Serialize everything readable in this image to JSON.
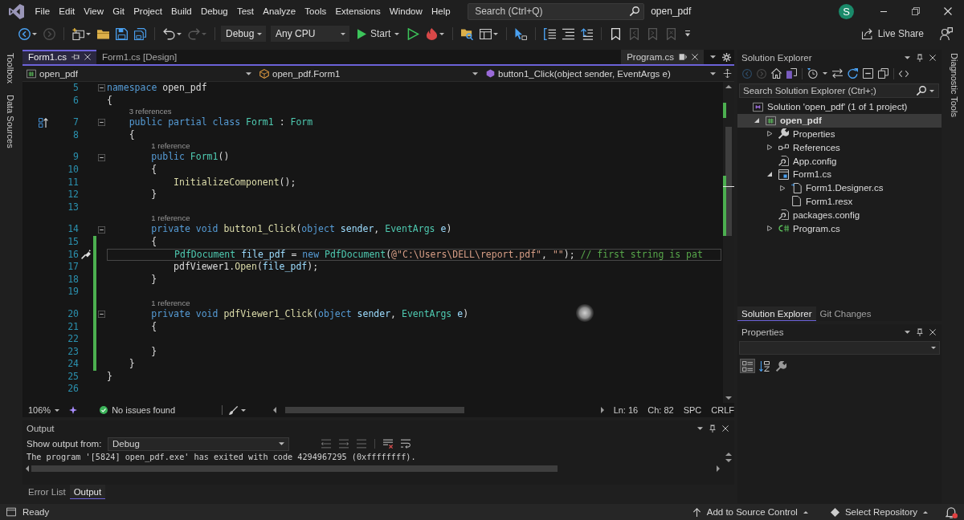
{
  "window": {
    "menu": [
      "File",
      "Edit",
      "View",
      "Git",
      "Project",
      "Build",
      "Debug",
      "Test",
      "Analyze",
      "Tools",
      "Extensions",
      "Window",
      "Help"
    ],
    "search": {
      "placeholder": "Search (Ctrl+Q)"
    },
    "title": "open_pdf",
    "account": {
      "initial": "S"
    }
  },
  "toolbar": {
    "groups_before": [
      [
        {
          "kind": "back",
          "dropdown": true,
          "disabled": false
        },
        {
          "kind": "forward",
          "dropdown": false,
          "disabled": true
        }
      ],
      [
        {
          "kind": "new",
          "dropdown": true,
          "disabled": false
        },
        {
          "kind": "open",
          "dropdown": false,
          "disabled": false
        },
        {
          "kind": "save",
          "dropdown": false,
          "disabled": false
        },
        {
          "kind": "save_all",
          "dropdown": false,
          "disabled": false
        }
      ],
      [
        {
          "kind": "undo",
          "dropdown": true,
          "disabled": false
        },
        {
          "kind": "redo",
          "dropdown": true,
          "disabled": true
        }
      ]
    ],
    "configuration": "Debug",
    "platform": "Any CPU",
    "start": "Start",
    "groups_after": [
      [
        {
          "kind": "run",
          "dropdown": false,
          "disabled": false
        },
        {
          "kind": "hot_reload",
          "dropdown": true,
          "disabled": false
        }
      ],
      [
        {
          "kind": "browse",
          "dropdown": false,
          "disabled": false
        },
        {
          "kind": "layout",
          "dropdown": true,
          "disabled": false
        }
      ],
      [
        {
          "kind": "select",
          "dropdown": false,
          "disabled": false
        }
      ],
      [
        {
          "kind": "format",
          "dropdown": false,
          "disabled": false
        },
        {
          "kind": "comment",
          "dropdown": false,
          "disabled": false
        },
        {
          "kind": "uncomment",
          "dropdown": false,
          "disabled": false
        }
      ],
      [
        {
          "kind": "bookmark",
          "dropdown": false,
          "disabled": false
        },
        {
          "kind": "bookmark_prev",
          "dropdown": false,
          "disabled": true
        },
        {
          "kind": "bookmark_next",
          "dropdown": false,
          "disabled": true
        },
        {
          "kind": "bookmark_clear",
          "dropdown": false,
          "disabled": true
        }
      ]
    ],
    "live_share": "Live Share"
  },
  "left_strip": [
    "Toolbox",
    "Data Sources"
  ],
  "editor": {
    "tabs": [
      {
        "label": "Form1.cs",
        "selected": true
      },
      {
        "label": "Form1.cs [Design]",
        "selected": false
      }
    ],
    "preview_tab": {
      "label": "Program.cs"
    },
    "nav": {
      "project": "open_pdf",
      "type": "open_pdf.Form1",
      "member": "button1_Click(object sender, EventArgs e)"
    },
    "lines": [
      {
        "kind": "code",
        "number": "5",
        "tokens": [
          {
            "text": "namespace",
            "kind": "keyword"
          },
          {
            "text": " open_pdf",
            "kind": "plain"
          }
        ],
        "fold": true,
        "changed": false,
        "current": false
      },
      {
        "kind": "code",
        "number": "6",
        "tokens": [
          {
            "text": "{",
            "kind": "plain"
          }
        ],
        "fold": false,
        "changed": false,
        "current": false
      },
      {
        "kind": "codelens",
        "text": "3 references",
        "changed": false
      },
      {
        "kind": "code",
        "number": "7",
        "tokens": [
          {
            "text": "    public partial class",
            "kind": "keyword"
          },
          {
            "text": " Form1",
            "kind": "type"
          },
          {
            "text": " : ",
            "kind": "plain"
          },
          {
            "text": "Form",
            "kind": "type"
          }
        ],
        "fold": true,
        "changed": false,
        "current": false,
        "margin_icon": {
          "kind": "inheritance"
        }
      },
      {
        "kind": "code",
        "number": "8",
        "tokens": [
          {
            "text": "    {",
            "kind": "plain"
          }
        ],
        "fold": false,
        "changed": false,
        "current": false
      },
      {
        "kind": "codelens",
        "text": "1 reference",
        "changed": false
      },
      {
        "kind": "code",
        "number": "9",
        "tokens": [
          {
            "text": "        public",
            "kind": "keyword"
          },
          {
            "text": " Form1",
            "kind": "type"
          },
          {
            "text": "()",
            "kind": "plain"
          }
        ],
        "fold": true,
        "changed": false,
        "current": false
      },
      {
        "kind": "code",
        "number": "10",
        "tokens": [
          {
            "text": "        {",
            "kind": "plain"
          }
        ],
        "fold": false,
        "changed": false,
        "current": false
      },
      {
        "kind": "code",
        "number": "11",
        "tokens": [
          {
            "text": "            InitializeComponent",
            "kind": "method"
          },
          {
            "text": "();",
            "kind": "plain"
          }
        ],
        "fold": false,
        "changed": false,
        "current": false
      },
      {
        "kind": "code",
        "number": "12",
        "tokens": [
          {
            "text": "        }",
            "kind": "plain"
          }
        ],
        "fold": false,
        "changed": false,
        "current": false
      },
      {
        "kind": "code",
        "number": "13",
        "fold": false,
        "changed": false,
        "current": false
      },
      {
        "kind": "codelens",
        "text": "1 reference",
        "changed": false
      },
      {
        "kind": "code",
        "number": "14",
        "tokens": [
          {
            "text": "        private void",
            "kind": "keyword"
          },
          {
            "text": " button1_Click",
            "kind": "method"
          },
          {
            "text": "(",
            "kind": "plain"
          },
          {
            "text": "object",
            "kind": "keyword"
          },
          {
            "text": " sender",
            "kind": "param"
          },
          {
            "text": ", ",
            "kind": "plain"
          },
          {
            "text": "EventArgs",
            "kind": "type"
          },
          {
            "text": " e",
            "kind": "param"
          },
          {
            "text": ")",
            "kind": "plain"
          }
        ],
        "fold": true,
        "changed": false,
        "current": false
      },
      {
        "kind": "code",
        "number": "15",
        "tokens": [
          {
            "text": "        {",
            "kind": "plain"
          }
        ],
        "fold": false,
        "changed": true,
        "current": false
      },
      {
        "kind": "code",
        "number": "16",
        "tokens": [
          {
            "text": "            PdfDocument",
            "kind": "type"
          },
          {
            "text": " file_pdf",
            "kind": "param"
          },
          {
            "text": " = ",
            "kind": "plain"
          },
          {
            "text": "new",
            "kind": "keyword"
          },
          {
            "text": " PdfDocument",
            "kind": "type"
          },
          {
            "text": "(",
            "kind": "plain"
          },
          {
            "text": "@\"C:\\Users\\DELL\\report.pdf\"",
            "kind": "string"
          },
          {
            "text": ", ",
            "kind": "plain"
          },
          {
            "text": "\"\"",
            "kind": "string"
          },
          {
            "text": ");",
            "kind": "plain"
          },
          {
            "text": " // first string is pat",
            "kind": "comment"
          }
        ],
        "fold": false,
        "changed": true,
        "current": true,
        "margin_icon": {
          "kind": "quick_actions"
        }
      },
      {
        "kind": "code",
        "number": "17",
        "tokens": [
          {
            "text": "            pdfViewer1.",
            "kind": "plain"
          },
          {
            "text": "Open",
            "kind": "method"
          },
          {
            "text": "(",
            "kind": "plain"
          },
          {
            "text": "file_pdf",
            "kind": "param"
          },
          {
            "text": ");",
            "kind": "plain"
          }
        ],
        "fold": false,
        "changed": true,
        "current": false
      },
      {
        "kind": "code",
        "number": "18",
        "tokens": [
          {
            "text": "        }",
            "kind": "plain"
          }
        ],
        "fold": false,
        "changed": true,
        "current": false
      },
      {
        "kind": "code",
        "number": "19",
        "fold": false,
        "changed": true,
        "current": false
      },
      {
        "kind": "codelens",
        "text": "1 reference",
        "changed": true
      },
      {
        "kind": "code",
        "number": "20",
        "tokens": [
          {
            "text": "        private void",
            "kind": "keyword"
          },
          {
            "text": " pdfViewer1_Click",
            "kind": "method"
          },
          {
            "text": "(",
            "kind": "plain"
          },
          {
            "text": "object",
            "kind": "keyword"
          },
          {
            "text": " sender",
            "kind": "param"
          },
          {
            "text": ", ",
            "kind": "plain"
          },
          {
            "text": "EventArgs",
            "kind": "type"
          },
          {
            "text": " e",
            "kind": "param"
          },
          {
            "text": ")",
            "kind": "plain"
          }
        ],
        "fold": true,
        "changed": true,
        "current": false
      },
      {
        "kind": "code",
        "number": "21",
        "tokens": [
          {
            "text": "        {",
            "kind": "plain"
          }
        ],
        "fold": false,
        "changed": true,
        "current": false
      },
      {
        "kind": "code",
        "number": "22",
        "fold": false,
        "changed": true,
        "current": false
      },
      {
        "kind": "code",
        "number": "23",
        "tokens": [
          {
            "text": "        }",
            "kind": "plain"
          }
        ],
        "fold": false,
        "changed": true,
        "current": false
      },
      {
        "kind": "code",
        "number": "24",
        "tokens": [
          {
            "text": "    }",
            "kind": "plain"
          }
        ],
        "fold": false,
        "changed": true,
        "current": false
      },
      {
        "kind": "code",
        "number": "25",
        "tokens": [
          {
            "text": "}",
            "kind": "plain"
          }
        ],
        "fold": false,
        "changed": false,
        "current": false
      },
      {
        "kind": "code",
        "number": "26",
        "fold": false,
        "changed": false,
        "current": false
      }
    ],
    "status": {
      "zoom": "106%",
      "issues": "No issues found",
      "line": "Ln: 16",
      "column": "Ch: 82",
      "indent": "SPC",
      "line_ending": "CRLF"
    }
  },
  "output": {
    "title": "Output",
    "source_label": "Show output from:",
    "source": "Debug",
    "text": "The program '[5824] open_pdf.exe' has exited with code 4294967295 (0xffffffff).",
    "tabs": [
      {
        "label": "Error List",
        "selected": false
      },
      {
        "label": "Output",
        "selected": true
      }
    ]
  },
  "solution_explorer": {
    "title": "Solution Explorer",
    "search": {
      "placeholder": "Search Solution Explorer (Ctrl+;)"
    },
    "tree": [
      {
        "label": "Solution 'open_pdf' (1 of 1 project)",
        "kind": "solution",
        "selected": false,
        "children": [
          {
            "label": "open_pdf",
            "kind": "project",
            "expanded": true,
            "selected": true,
            "children": [
              {
                "label": "Properties",
                "kind": "properties",
                "expanded": false,
                "selected": false
              },
              {
                "label": "References",
                "kind": "references",
                "expanded": false,
                "selected": false
              },
              {
                "label": "App.config",
                "kind": "config",
                "selected": false
              },
              {
                "label": "Form1.cs",
                "kind": "form",
                "expanded": true,
                "selected": false,
                "children": [
                  {
                    "label": "Form1.Designer.cs",
                    "kind": "source",
                    "expanded": false,
                    "selected": false
                  },
                  {
                    "label": "Form1.resx",
                    "kind": "resource",
                    "selected": false
                  }
                ]
              },
              {
                "label": "packages.config",
                "kind": "config",
                "selected": false
              },
              {
                "label": "Program.cs",
                "kind": "csharp",
                "expanded": false,
                "selected": false
              }
            ]
          }
        ]
      }
    ],
    "tabs": [
      {
        "label": "Solution Explorer",
        "selected": true
      },
      {
        "label": "Git Changes",
        "selected": false
      }
    ]
  },
  "properties": {
    "title": "Properties",
    "view_buttons": [
      {
        "kind": "categorized",
        "selected": true
      },
      {
        "kind": "alphabetical",
        "selected": false
      },
      {
        "kind": "property_pages",
        "selected": false
      }
    ]
  },
  "right_strip": [
    "Diagnostic Tools"
  ],
  "status_bar": {
    "text": "Ready",
    "source_control": "Add to Source Control",
    "repository": "Select Repository"
  }
}
